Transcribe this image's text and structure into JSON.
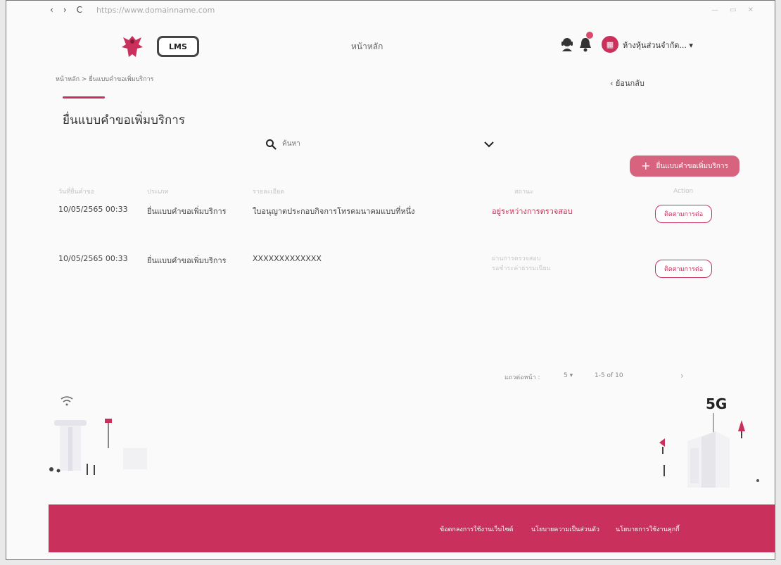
{
  "browser": {
    "back": "‹",
    "forward": "›",
    "reload": "C",
    "url": "https://www.domainname.com",
    "minimize": "—",
    "restore": "▭",
    "close": "✕"
  },
  "header": {
    "logo_text": "LMS",
    "nav_home": "หน้าหลัก",
    "company_name": "ห้างหุ้นส่วนจำกัด...",
    "company_dropdown": "▾",
    "company_glyph": "▦"
  },
  "breadcrumb": {
    "home": "หน้าหลัก",
    "separator": ">",
    "current": "ยื่นแบบคำขอเพิ่มบริการ"
  },
  "back_link": "‹  ย้อนกลับ",
  "page_title": "ยื่นแบบคำขอเพิ่มบริการ",
  "search": {
    "placeholder": "ค้นหา"
  },
  "add_button": {
    "icon": "+",
    "label": "ยื่นแบบคำขอเพิ่มบริการ"
  },
  "table": {
    "headers": [
      "วันที่ยื่นคำขอ",
      "ประเภท",
      "รายละเอียด",
      "สถานะ",
      "Action"
    ],
    "rows": [
      {
        "date": "10/05/2565 00:33",
        "type": "ยื่นแบบคำขอเพิ่มบริการ",
        "detail": "ใบอนุญาตประกอบกิจการโทรคมนาคมแบบที่หนึ่ง",
        "status": "อยู่ระหว่างการตรวจสอบ",
        "status_sub": "",
        "action": "ติดตามการต่อ"
      },
      {
        "date": "10/05/2565 00:33",
        "type": "ยื่นแบบคำขอเพิ่มบริการ",
        "detail": "XXXXXXXXXXXXX",
        "status": "ผ่านการตรวจสอบ",
        "status_sub": "รอชำระค่าธรรมเนียม",
        "action": "ติดตามการต่อ"
      }
    ]
  },
  "pagination": {
    "rows_label": "แถวต่อหน้า :",
    "rows_value": "5  ▾",
    "range": "1-5 of 10",
    "next": "›"
  },
  "illustration": {
    "badge": "5G"
  },
  "footer": {
    "links": [
      "ข้อตกลงการใช้งานเว็บไซต์",
      "นโยบายความเป็นส่วนตัว",
      "นโยบายการใช้งานคุกกี้"
    ]
  },
  "colors": {
    "brand": "#c9305b",
    "button": "#d8637e",
    "footer": "#c9305b"
  }
}
